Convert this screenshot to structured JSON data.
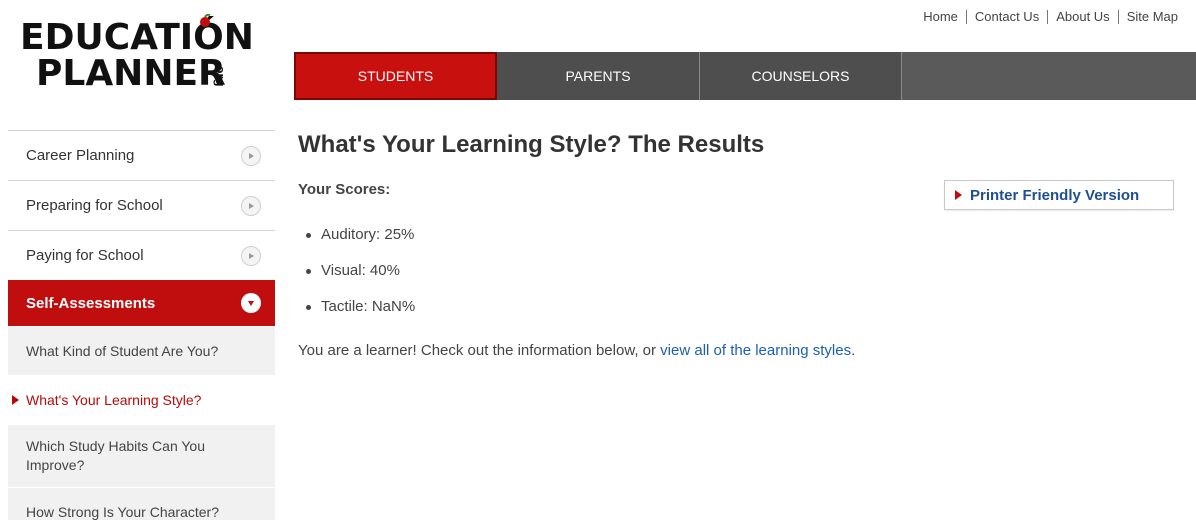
{
  "logo": {
    "line1": "EDUCATIÓN",
    "line2": "PLANNER",
    "suffix": ".org",
    "accent_color": "#c00d0d"
  },
  "top_links": [
    "Home",
    "Contact Us",
    "About Us",
    "Site Map"
  ],
  "main_nav": {
    "tabs": [
      {
        "label": "STUDENTS",
        "active": true
      },
      {
        "label": "PARENTS",
        "active": false
      },
      {
        "label": "COUNSELORS",
        "active": false
      }
    ]
  },
  "sidebar": {
    "items": [
      {
        "label": "Career Planning",
        "icon": "play-circle-icon"
      },
      {
        "label": "Preparing for School",
        "icon": "play-circle-icon"
      },
      {
        "label": "Paying for School",
        "icon": "play-circle-icon"
      },
      {
        "label": "Self-Assessments",
        "icon": "chevron-down-circle-icon",
        "active": true
      }
    ],
    "sub_items": [
      {
        "label": "What Kind of Student Are You?"
      },
      {
        "label": "What's Your Learning Style?",
        "current": true
      },
      {
        "label": "Which Study Habits Can You Improve?"
      },
      {
        "label": "How Strong Is Your Character?"
      }
    ]
  },
  "content": {
    "title": "What's Your Learning Style? The Results",
    "scores_label": "Your Scores:",
    "scores": [
      {
        "text": "Auditory: 25%"
      },
      {
        "text": "Visual: 40%"
      },
      {
        "text": "Tactile: NaN%"
      }
    ],
    "result_prefix": "You are a learner! Check out the information below, or ",
    "result_link": "view all of the learning styles",
    "result_suffix": ".",
    "printer_button": "Printer Friendly Version"
  },
  "colors": {
    "brand_red": "#c00d0d",
    "nav_gray": "#5a5a5a",
    "link_blue": "#1b5fb3"
  }
}
